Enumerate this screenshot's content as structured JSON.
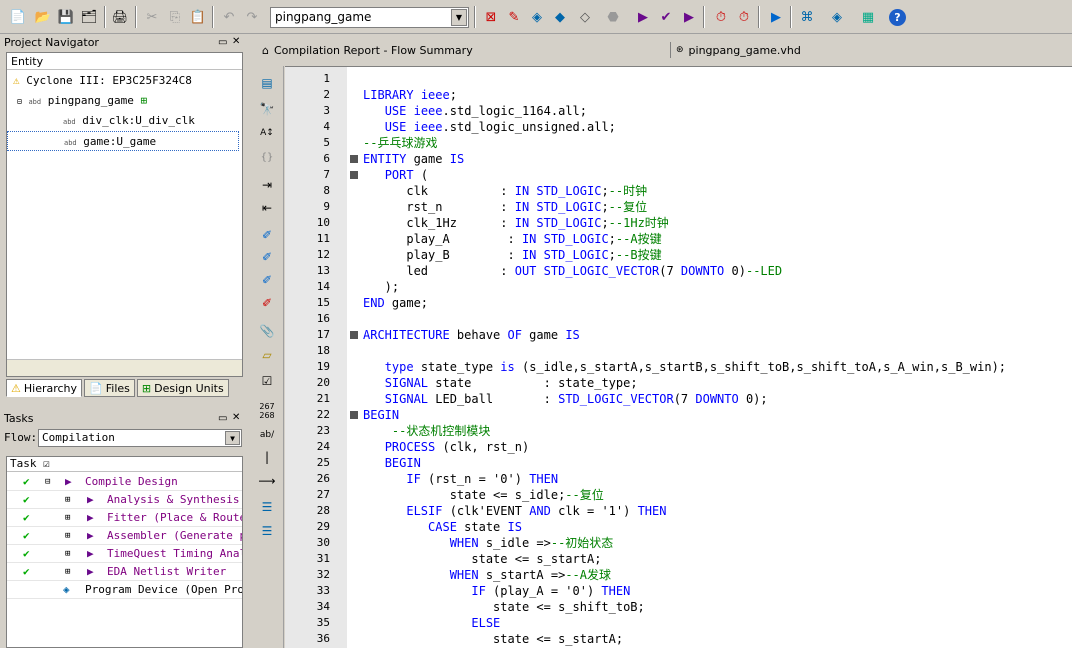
{
  "toolbar": {
    "project_combo": "pingpang_game",
    "icons": [
      "new-icon",
      "open-icon",
      "save-icon",
      "save-all-icon",
      "print-icon",
      "cut-icon",
      "copy-icon",
      "paste-icon",
      "undo-icon",
      "redo-icon",
      "chip-planner-icon",
      "pin-planner-icon",
      "assignment-editor-icon",
      "settings-icon",
      "stop-icon",
      "start-compile-icon",
      "analysis-icon",
      "timing-icon",
      "fitter-icon",
      "timequest-icon",
      "simulator-icon",
      "programmer-icon",
      "netlist-icon",
      "chip-icon",
      "help-icon"
    ]
  },
  "navigator": {
    "title": "Project Navigator",
    "header": "Entity",
    "device": "Cyclone III: EP3C25F324C8",
    "items": [
      {
        "label": "pingpang_game"
      },
      {
        "label": "div_clk:U_div_clk"
      },
      {
        "label": "game:U_game"
      }
    ],
    "tabs": [
      "Hierarchy",
      "Files",
      "Design Units"
    ]
  },
  "tasks": {
    "title": "Tasks",
    "flow_label": "Flow:",
    "flow_value": "Compilation",
    "header": "Task",
    "rows": [
      {
        "label": "Compile Design",
        "status": "done"
      },
      {
        "label": "Analysis & Synthesis",
        "status": "done"
      },
      {
        "label": "Fitter (Place & Route)",
        "status": "done"
      },
      {
        "label": "Assembler (Generate pro",
        "status": "done"
      },
      {
        "label": "TimeQuest Timing Analys",
        "status": "done"
      },
      {
        "label": "EDA Netlist Writer",
        "status": "done"
      },
      {
        "label": "Program Device (Open Progr",
        "status": "none"
      }
    ]
  },
  "editor": {
    "tabs": [
      "Compilation Report - Flow Summary",
      "pingpang_game.vhd"
    ],
    "lines": [
      "",
      "LIBRARY ieee;",
      "   USE ieee.std_logic_1164.all;",
      "   USE ieee.std_logic_unsigned.all;",
      "--乒乓球游戏",
      "ENTITY game IS",
      "   PORT (",
      "      clk          : IN STD_LOGIC;--时钟",
      "      rst_n        : IN STD_LOGIC;--复位",
      "      clk_1Hz      : IN STD_LOGIC;--1Hz时钟",
      "      play_A        : IN STD_LOGIC;--A按键",
      "      play_B        : IN STD_LOGIC;--B按键",
      "      led          : OUT STD_LOGIC_VECTOR(7 DOWNTO 0)--LED",
      "   );",
      "END game;",
      "",
      "ARCHITECTURE behave OF game IS",
      "",
      "   type state_type is (s_idle,s_startA,s_startB,s_shift_toB,s_shift_toA,s_A_win,s_B_win);",
      "   SIGNAL state          : state_type;",
      "   SIGNAL LED_ball       : STD_LOGIC_VECTOR(7 DOWNTO 0);",
      "BEGIN",
      "    --状态机控制模块",
      "   PROCESS (clk, rst_n)",
      "   BEGIN",
      "      IF (rst_n = '0') THEN",
      "            state <= s_idle;--复位",
      "      ELSIF (clk'EVENT AND clk = '1') THEN",
      "         CASE state IS",
      "            WHEN s_idle =>--初始状态",
      "               state <= s_startA;",
      "            WHEN s_startA =>--A发球",
      "               IF (play_A = '0') THEN",
      "                  state <= s_shift_toB;",
      "               ELSE",
      "                  state <= s_startA;"
    ]
  }
}
